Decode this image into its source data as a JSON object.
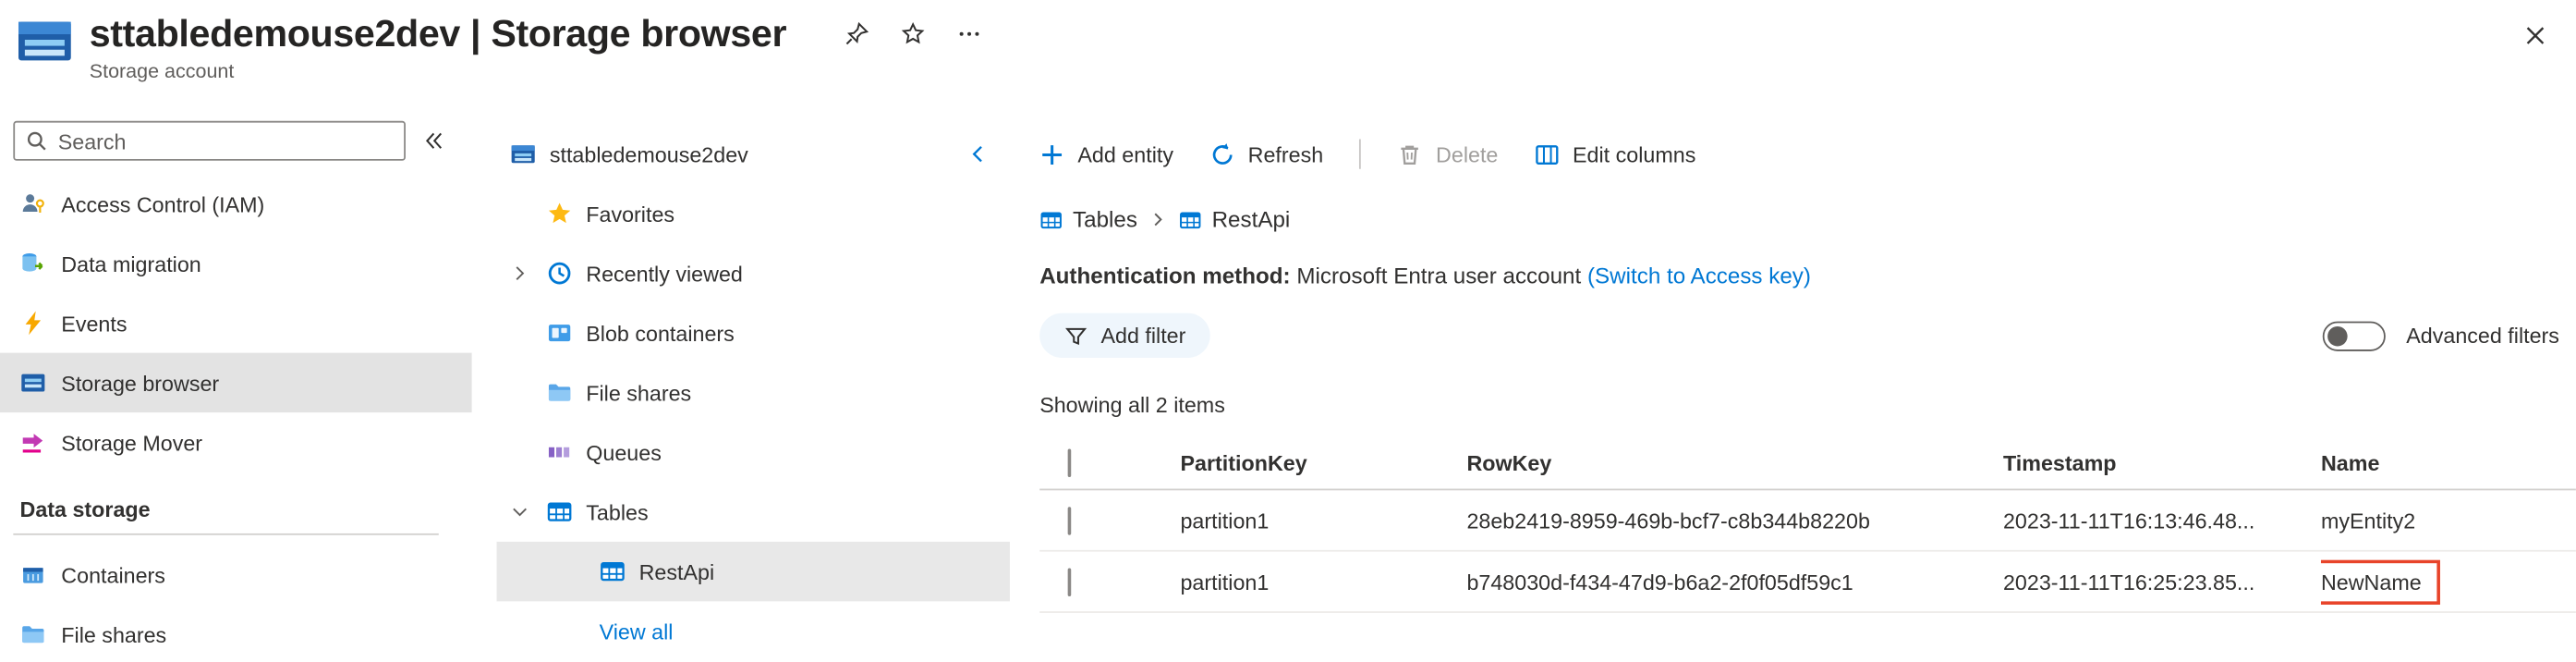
{
  "header": {
    "title": "sttabledemouse2dev | Storage browser",
    "subtitle": "Storage account"
  },
  "sidebar": {
    "search_placeholder": "Search",
    "items": [
      {
        "label": "Access Control (IAM)"
      },
      {
        "label": "Data migration"
      },
      {
        "label": "Events"
      },
      {
        "label": "Storage browser",
        "selected": true
      },
      {
        "label": "Storage Mover"
      }
    ],
    "section_title": "Data storage",
    "section_items": [
      {
        "label": "Containers"
      },
      {
        "label": "File shares"
      }
    ]
  },
  "tree": {
    "root_label": "sttabledemouse2dev",
    "items": [
      {
        "label": "Favorites"
      },
      {
        "label": "Recently viewed",
        "expander": "collapsed"
      },
      {
        "label": "Blob containers"
      },
      {
        "label": "File shares"
      },
      {
        "label": "Queues"
      },
      {
        "label": "Tables",
        "expander": "expanded"
      },
      {
        "label": "RestApi",
        "selected": true
      }
    ],
    "view_all": "View all"
  },
  "toolbar": {
    "add_entity": "Add entity",
    "refresh": "Refresh",
    "delete": "Delete",
    "delete_disabled": true,
    "edit_columns": "Edit columns"
  },
  "breadcrumb": {
    "items": [
      "Tables",
      "RestApi"
    ]
  },
  "auth": {
    "label": "Authentication method:",
    "value": "Microsoft Entra user account",
    "link": "(Switch to Access key)"
  },
  "filters": {
    "add_filter": "Add filter",
    "advanced_filters": "Advanced filters",
    "toggle_state": "off"
  },
  "status": {
    "showing": "Showing all 2 items"
  },
  "table": {
    "columns": [
      "PartitionKey",
      "RowKey",
      "Timestamp",
      "Name"
    ],
    "rows": [
      {
        "partition_key": "partition1",
        "row_key": "28eb2419-8959-469b-bcf7-c8b344b8220b",
        "timestamp": "2023-11-11T16:13:46.48...",
        "name": "myEntity2",
        "highlighted": false
      },
      {
        "partition_key": "partition1",
        "row_key": "b748030d-f434-47d9-b6a2-2f0f05df59c1",
        "timestamp": "2023-11-11T16:25:23.85...",
        "name": "NewName",
        "highlighted": true
      }
    ]
  },
  "icons": {
    "search-icon": "magnifier",
    "collapse-sidebar-icon": "double chevron left",
    "pin-icon": "pin",
    "favorite-star-icon": "star outline",
    "more-options-icon": "ellipsis",
    "close-icon": "x",
    "events-icon": "lightning bolt",
    "favorites-star-icon": "gold star",
    "recently-viewed-icon": "clock",
    "tables-icon": "table grid",
    "add-icon": "plus",
    "refresh-icon": "circular arrow",
    "delete-icon": "trash can",
    "edit-columns-icon": "column grid",
    "filter-icon": "funnel",
    "chevron-right-icon": "expander collapsed",
    "chevron-down-icon": "expander expanded",
    "chevron-left-icon": "panel collapse"
  },
  "colors": {
    "accent": "#0078d4",
    "text_primary": "#323130",
    "text_secondary": "#605e5c",
    "disabled": "#a19f9d",
    "selected_bg": "#e3e3e3",
    "pill_bg": "#eff6fc",
    "highlight_border": "#e8442a",
    "events_yellow": "#f8a800",
    "star_gold": "#fdb913",
    "mover_pink": "#c239b3"
  }
}
